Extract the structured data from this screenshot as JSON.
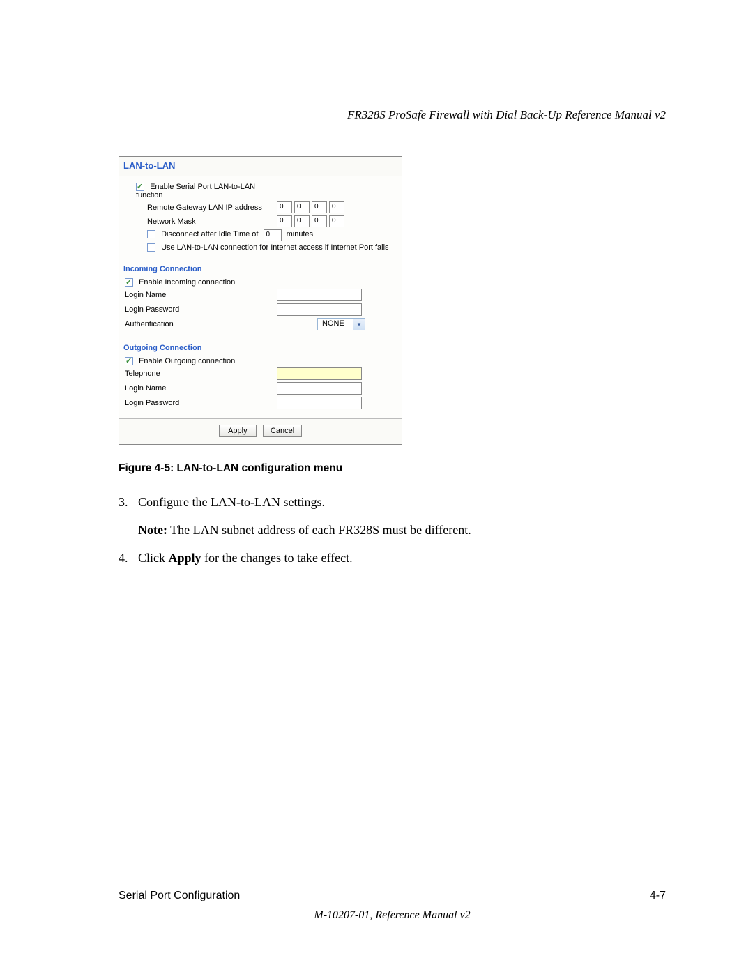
{
  "header_title": "FR328S ProSafe Firewall with Dial Back-Up Reference Manual v2",
  "panel": {
    "title": "LAN-to-LAN",
    "enable_serial_label": "Enable Serial Port LAN-to-LAN function",
    "remote_gw_label": "Remote Gateway LAN IP address",
    "remote_gw_ip": [
      "0",
      "0",
      "0",
      "0"
    ],
    "netmask_label": "Network Mask",
    "netmask_ip": [
      "0",
      "0",
      "0",
      "0"
    ],
    "disconnect_label_pre": "Disconnect after Idle Time of",
    "disconnect_value": "0",
    "disconnect_label_post": "minutes",
    "fallback_label": "Use LAN-to-LAN connection for Internet access if Internet Port fails",
    "incoming_header": "Incoming Connection",
    "enable_incoming_label": "Enable Incoming connection",
    "login_name_label": "Login Name",
    "login_password_label": "Login Password",
    "auth_label": "Authentication",
    "auth_value": "NONE",
    "outgoing_header": "Outgoing Connection",
    "enable_outgoing_label": "Enable Outgoing connection",
    "telephone_label": "Telephone",
    "apply_label": "Apply",
    "cancel_label": "Cancel"
  },
  "figure_caption": "Figure 4-5:  LAN-to-LAN configuration menu",
  "step3_num": "3.",
  "step3_text": "Configure the LAN-to-LAN settings.",
  "note_label": "Note:",
  "note_text": " The LAN subnet address of each FR328S must be different.",
  "step4_num": "4.",
  "step4_pre": "Click ",
  "step4_bold": "Apply",
  "step4_post": " for the changes to take effect.",
  "footer_left": "Serial Port Configuration",
  "footer_right": "4-7",
  "footer_sub": "M-10207-01, Reference Manual v2"
}
